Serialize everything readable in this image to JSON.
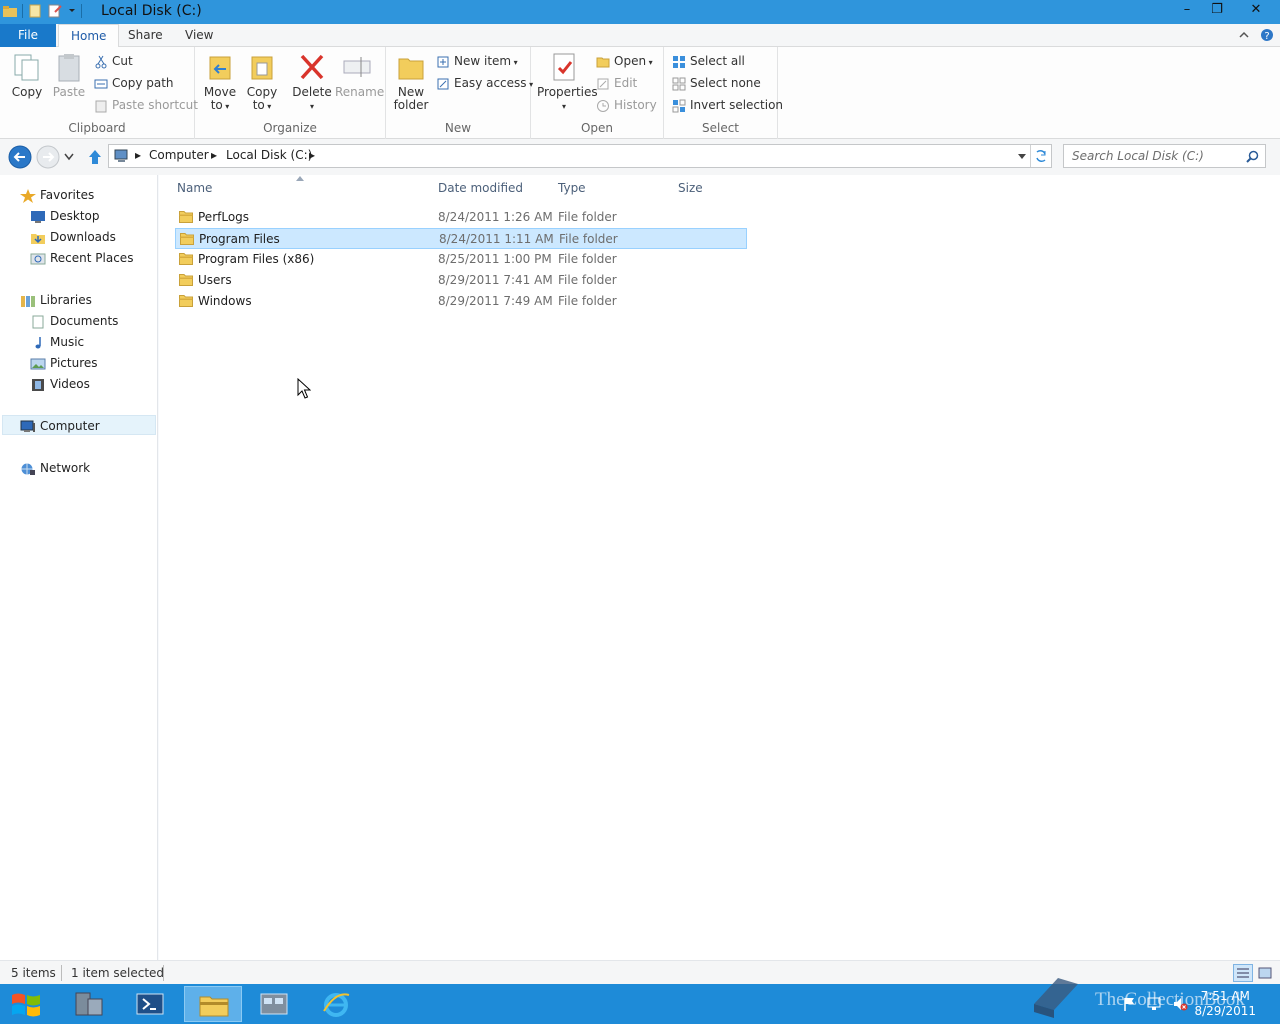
{
  "window": {
    "title": "Local Disk (C:)",
    "minimize_glyph": "–",
    "maximize_glyph": "❐",
    "close_glyph": "✕"
  },
  "ribbon_tabs": [
    {
      "label": "File"
    },
    {
      "label": "Home"
    },
    {
      "label": "Share"
    },
    {
      "label": "View"
    }
  ],
  "ribbon": {
    "clipboard": {
      "label": "Clipboard",
      "copy": "Copy",
      "paste": "Paste",
      "cut": "Cut",
      "copy_path": "Copy path",
      "paste_shortcut": "Paste shortcut"
    },
    "organize": {
      "label": "Organize",
      "move_to_1": "Move",
      "move_to_2": "to",
      "copy_to_1": "Copy",
      "copy_to_2": "to",
      "delete": "Delete",
      "rename": "Rename"
    },
    "new": {
      "label": "New",
      "new_folder_1": "New",
      "new_folder_2": "folder",
      "new_item": "New item",
      "easy_access": "Easy access"
    },
    "open": {
      "label": "Open",
      "properties": "Properties",
      "open": "Open",
      "edit": "Edit",
      "history": "History"
    },
    "select": {
      "label": "Select",
      "select_all": "Select all",
      "select_none": "Select none",
      "invert_selection": "Invert selection"
    }
  },
  "address": {
    "crumbs": [
      "Computer",
      "Local Disk (C:)"
    ],
    "search_placeholder": "Search Local Disk (C:)"
  },
  "sidebar": {
    "favorites": {
      "label": "Favorites",
      "items": [
        "Desktop",
        "Downloads",
        "Recent Places"
      ]
    },
    "libraries": {
      "label": "Libraries",
      "items": [
        "Documents",
        "Music",
        "Pictures",
        "Videos"
      ]
    },
    "computer": "Computer",
    "network": "Network"
  },
  "file_list": {
    "columns": [
      "Name",
      "Date modified",
      "Type",
      "Size"
    ],
    "rows": [
      {
        "name": "PerfLogs",
        "date": "8/24/2011 1:26 AM",
        "type": "File folder",
        "size": ""
      },
      {
        "name": "Program Files",
        "date": "8/24/2011 1:11 AM",
        "type": "File folder",
        "size": ""
      },
      {
        "name": "Program Files (x86)",
        "date": "8/25/2011 1:00 PM",
        "type": "File folder",
        "size": ""
      },
      {
        "name": "Users",
        "date": "8/29/2011 7:41 AM",
        "type": "File folder",
        "size": ""
      },
      {
        "name": "Windows",
        "date": "8/29/2011 7:49 AM",
        "type": "File folder",
        "size": ""
      }
    ],
    "selected_index": 1
  },
  "status": {
    "item_count": "5 items",
    "selection": "1 item selected"
  },
  "taskbar": {
    "time": "7:51 AM",
    "date": "8/29/2011",
    "watermark": "TheCollectionBook"
  },
  "colors": {
    "accent": "#1979ca",
    "titlebar": "#2f95dc",
    "taskbar": "#1e8bd8",
    "selection": "#cce8ff"
  }
}
